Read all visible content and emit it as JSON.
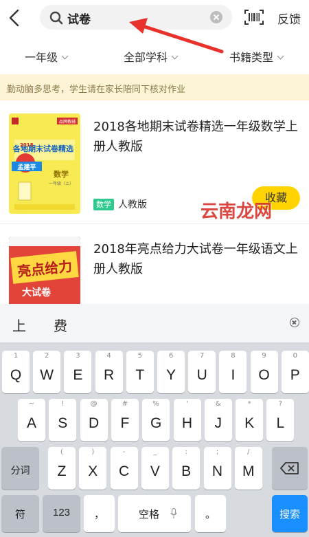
{
  "search": {
    "query": "试卷",
    "feedback_label": "反馈"
  },
  "filters": [
    {
      "label": "一年级"
    },
    {
      "label": "全部学科"
    },
    {
      "label": "书籍类型"
    }
  ],
  "notice": "勤动脑多思考，学生请在家长陪同下核对作业",
  "books": [
    {
      "title": "2018各地期末试卷精选一年级数学上册人教版",
      "subject_tag": "数学",
      "edition": "人教版",
      "action": "收藏",
      "cover_text": {
        "brand": "孟建平",
        "series": "各地期末试卷精选",
        "year": "2018",
        "subject": "数学",
        "grade": "一年级（上）",
        "badge": "品牌教辅"
      }
    },
    {
      "title": "2018年亮点给力大试卷一年级语文上册人教版",
      "cover_text": {
        "brand": "亮点给力",
        "series": "大试卷"
      }
    }
  ],
  "keyboard": {
    "candidates": [
      "上",
      "费"
    ],
    "row1": [
      {
        "key": "Q",
        "hint": "1"
      },
      {
        "key": "W",
        "hint": "2"
      },
      {
        "key": "E",
        "hint": "3"
      },
      {
        "key": "R",
        "hint": "4"
      },
      {
        "key": "T",
        "hint": "5"
      },
      {
        "key": "Y",
        "hint": "6"
      },
      {
        "key": "U",
        "hint": "7"
      },
      {
        "key": "I",
        "hint": "8"
      },
      {
        "key": "O",
        "hint": "9"
      },
      {
        "key": "P",
        "hint": "0"
      }
    ],
    "row2": [
      {
        "key": "A",
        "hint": "~"
      },
      {
        "key": "S",
        "hint": "!"
      },
      {
        "key": "D",
        "hint": "@"
      },
      {
        "key": "F",
        "hint": "#"
      },
      {
        "key": "G",
        "hint": "%"
      },
      {
        "key": "H",
        "hint": "'"
      },
      {
        "key": "J",
        "hint": "&"
      },
      {
        "key": "K",
        "hint": "*"
      },
      {
        "key": "L",
        "hint": "?"
      }
    ],
    "row3": [
      {
        "key": "Z",
        "hint": "("
      },
      {
        "key": "X",
        "hint": ")"
      },
      {
        "key": "C",
        "hint": "-"
      },
      {
        "key": "V",
        "hint": "_"
      },
      {
        "key": "B",
        "hint": ":"
      },
      {
        "key": "N",
        "hint": ";"
      },
      {
        "key": "M",
        "hint": "/"
      }
    ],
    "fenci_label": "分词",
    "symbol_label": "符",
    "num_label": "123",
    "comma_label": "，",
    "space_label": "空格",
    "period_label": "。",
    "search_label": "搜索"
  },
  "watermark": "云南龙网",
  "colors": {
    "accent_yellow": "#ffd400",
    "tag_green": "#2ec98f",
    "notice_bg": "#fdf4d6",
    "arrow_red": "#e8322b",
    "search_key_blue": "#1a8fff"
  }
}
